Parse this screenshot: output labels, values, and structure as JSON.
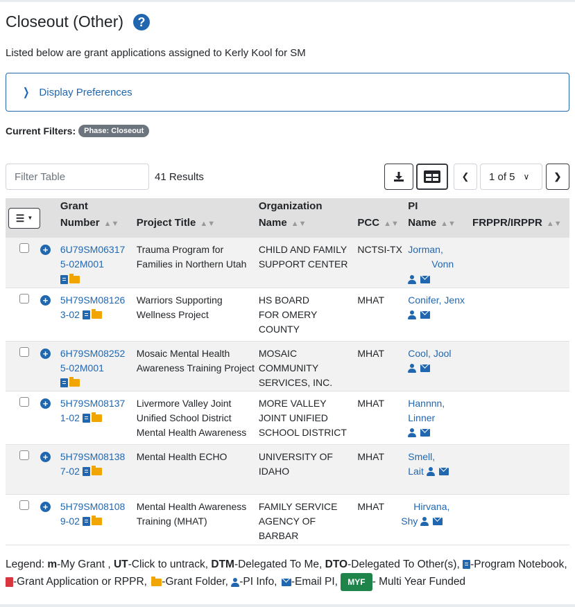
{
  "page": {
    "title": "Closeout (Other)",
    "subtitle": "Listed below are grant applications assigned to Kerly Kool for SM",
    "display_preferences": "Display Preferences",
    "current_filters_label": "Current Filters:",
    "filter_pill": "Phase: Closeout"
  },
  "toolbar": {
    "filter_placeholder": "Filter Table",
    "results": "41 Results",
    "page_select": "1 of 5"
  },
  "table": {
    "headers": {
      "grant_number_1": "Grant",
      "grant_number_2": "Number",
      "project_title": "Project Title",
      "org_1": "Organization",
      "org_2": "Name",
      "pcc": "PCC",
      "pi_1": "PI",
      "pi_2": "Name",
      "frppr": "FRPPR/IRPPR"
    },
    "rows": [
      {
        "grant_a": "6U79SM06317",
        "grant_b": "5-02M001",
        "title_a": "Trauma Program for",
        "title_b": "Families in Northern Utah",
        "title_c": "",
        "org_a": "CHILD AND FAMILY",
        "org_b": "SUPPORT CENTER",
        "org_c": "",
        "pcc": "NCTSI-TX",
        "pi_a": "Jorman,",
        "pi_b": "Vonn"
      },
      {
        "grant_a": "5H79SM08126",
        "grant_b": "3-02",
        "title_a": "Warriors Supporting",
        "title_b": "Wellness Project",
        "title_c": "",
        "org_a": "HS BOARD",
        "org_b": "FOR OMERY",
        "org_c": "COUNTY",
        "pcc": "MHAT",
        "pi_a": "Conifer, Jenx",
        "pi_b": ""
      },
      {
        "grant_a": "6H79SM08252",
        "grant_b": "5-02M001",
        "title_a": "Mosaic Mental Health",
        "title_b": "Awareness Training Project",
        "title_c": "",
        "org_a": "MOSAIC",
        "org_b": "COMMUNITY",
        "org_c": "SERVICES, INC.",
        "pcc": "MHAT",
        "pi_a": "Cool, Jool",
        "pi_b": ""
      },
      {
        "grant_a": "5H79SM08137",
        "grant_b": "1-02",
        "title_a": "Livermore Valley Joint",
        "title_b": "Unified School District",
        "title_c": "Mental Health Awareness",
        "org_a": "MORE VALLEY",
        "org_b": "JOINT UNIFIED",
        "org_c": "SCHOOL DISTRICT",
        "pcc": "MHAT",
        "pi_a": "Hannnn,",
        "pi_b": "Linner"
      },
      {
        "grant_a": "5H79SM08138",
        "grant_b": "7-02",
        "title_a": "Mental Health ECHO",
        "title_b": "",
        "title_c": "",
        "org_a": "UNIVERSITY OF",
        "org_b": "IDAHO",
        "org_c": "",
        "pcc": "MHAT",
        "pi_a": "Smell,",
        "pi_b": "Lait"
      },
      {
        "grant_a": "5H79SM08108",
        "grant_b": "9-02",
        "title_a": "Mental Health Awareness",
        "title_b": "Training (MHAT)",
        "title_c": "",
        "org_a": "FAMILY SERVICE",
        "org_b": "AGENCY OF",
        "org_c": "BARBAR",
        "pcc": "MHAT",
        "pi_a": "Hirvana,",
        "pi_b": "Shy"
      }
    ]
  },
  "legend": {
    "prefix": "Legend: ",
    "m": "m",
    "m_text": "-My Grant , ",
    "ut": "UT",
    "ut_text": "-Click to untrack, ",
    "dtm": "DTM",
    "dtm_text": "-Delegated To Me, ",
    "dto": "DTO",
    "dto_text": "-Delegated To Other(s), ",
    "notebook_text": "-Program Notebook, ",
    "pdf_text": "-Grant Application or RPPR, ",
    "folder_text": "-Grant Folder, ",
    "pi_text": "-PI Info, ",
    "email_text": "-Email PI, ",
    "myf": "MYF",
    "myf_text": "- Multi Year Funded"
  },
  "colors": {
    "accent": "#2167b0",
    "folder": "#f0a500",
    "pdf": "#d9363e",
    "myf": "#1e8449"
  }
}
